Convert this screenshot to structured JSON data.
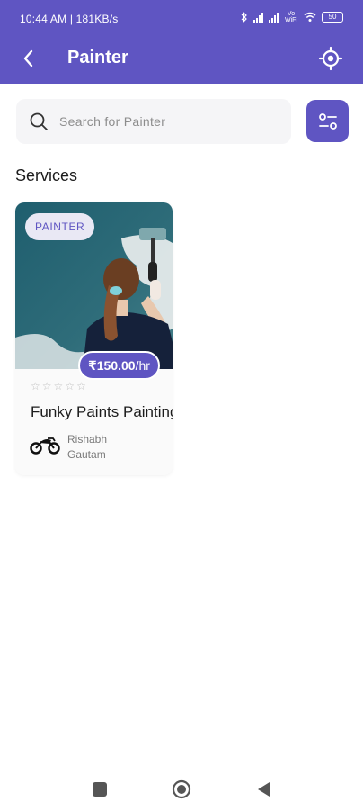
{
  "status_bar": {
    "time_speed": "10:44 AM | 181KB/s",
    "network_label": "Vo WiFi",
    "battery": "50"
  },
  "app_bar": {
    "title": "Painter",
    "back_icon": "chevron-left-icon",
    "location_icon": "gps-target-icon"
  },
  "search": {
    "placeholder": "Search for Painter",
    "value": "",
    "icon": "search-icon"
  },
  "filter": {
    "icon": "sliders-icon"
  },
  "section": {
    "title": "Services"
  },
  "services": [
    {
      "category": "PAINTER",
      "price": "₹150.00",
      "unit": "/hr",
      "rating": 0,
      "rating_max": 5,
      "title": "Funky Paints Painting",
      "provider_name": "Rishabh Gautam",
      "provider_icon": "motorbike-icon"
    }
  ],
  "colors": {
    "primary": "#5f55c2",
    "chip_bg": "#e9e8f4",
    "search_bg": "#f5f5f7"
  },
  "nav": {
    "recents_icon": "square-icon",
    "home_icon": "circle-icon",
    "back_icon": "triangle-back-icon"
  }
}
